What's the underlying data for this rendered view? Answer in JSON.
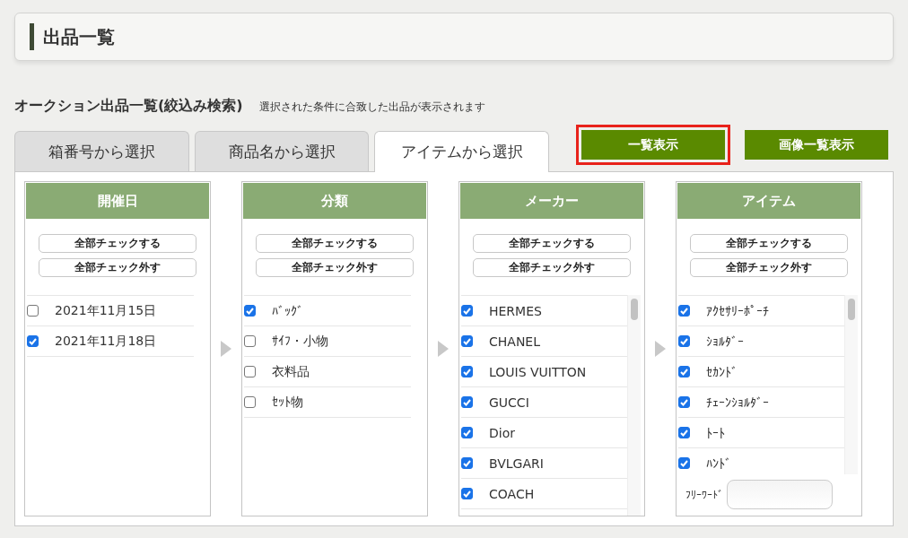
{
  "header": {
    "title": "出品一覧"
  },
  "section": {
    "title": "オークション出品一覧(絞込み検索)",
    "note": "選択された条件に合致した出品が表示されます"
  },
  "tabs": [
    {
      "label": "箱番号から選択",
      "selected": false
    },
    {
      "label": "商品名から選択",
      "selected": false
    },
    {
      "label": "アイテムから選択",
      "selected": true
    }
  ],
  "actions": [
    {
      "label": "一覧表示",
      "highlighted": true
    },
    {
      "label": "画像一覧表示",
      "highlighted": false
    }
  ],
  "columns": [
    {
      "title": "開催日",
      "check_all": "全部チェックする",
      "uncheck_all": "全部チェック外す",
      "scrollbar": false,
      "options": [
        {
          "label": "2021年11月15日",
          "checked": false
        },
        {
          "label": "2021年11月18日",
          "checked": true
        }
      ]
    },
    {
      "title": "分類",
      "check_all": "全部チェックする",
      "uncheck_all": "全部チェック外す",
      "scrollbar": false,
      "options": [
        {
          "label": "ﾊﾞｯｸﾞ",
          "checked": true
        },
        {
          "label": "ｻｲﾌ・小物",
          "checked": false
        },
        {
          "label": "衣料品",
          "checked": false
        },
        {
          "label": "ｾｯﾄ物",
          "checked": false
        }
      ]
    },
    {
      "title": "メーカー",
      "check_all": "全部チェックする",
      "uncheck_all": "全部チェック外す",
      "scrollbar": true,
      "options": [
        {
          "label": "HERMES",
          "checked": true
        },
        {
          "label": "CHANEL",
          "checked": true
        },
        {
          "label": "LOUIS VUITTON",
          "checked": true
        },
        {
          "label": "GUCCI",
          "checked": true
        },
        {
          "label": "Dior",
          "checked": true
        },
        {
          "label": "BVLGARI",
          "checked": true
        },
        {
          "label": "COACH",
          "checked": true
        }
      ]
    },
    {
      "title": "アイテム",
      "check_all": "全部チェックする",
      "uncheck_all": "全部チェック外す",
      "scrollbar": true,
      "options": [
        {
          "label": "ｱｸｾｻﾘｰﾎﾟｰﾁ",
          "checked": true
        },
        {
          "label": "ｼｮﾙﾀﾞｰ",
          "checked": true
        },
        {
          "label": "ｾｶﾝﾄﾞ",
          "checked": true
        },
        {
          "label": "ﾁｪｰﾝｼｮﾙﾀﾞｰ",
          "checked": true
        },
        {
          "label": "ﾄｰﾄ",
          "checked": true
        },
        {
          "label": "ﾊﾝﾄﾞ",
          "checked": true
        }
      ],
      "free_word": {
        "label": "ﾌﾘｰﾜｰﾄﾞ"
      }
    }
  ]
}
